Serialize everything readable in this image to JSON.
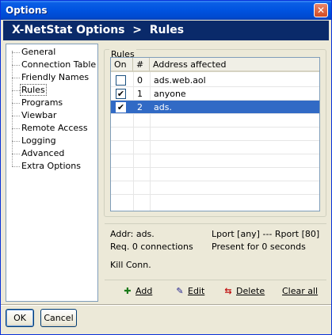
{
  "window": {
    "title": "Options",
    "close_glyph": "✕"
  },
  "header": {
    "app": "X-NetStat Options",
    "separator": ">",
    "section": "Rules"
  },
  "tree": {
    "items": [
      {
        "label": "General"
      },
      {
        "label": "Connection Table"
      },
      {
        "label": "Friendly Names"
      },
      {
        "label": "Rules",
        "selected": true
      },
      {
        "label": "Programs"
      },
      {
        "label": "Viewbar"
      },
      {
        "label": "Remote Access"
      },
      {
        "label": "Logging"
      },
      {
        "label": "Advanced"
      },
      {
        "label": "Extra Options"
      }
    ]
  },
  "rules": {
    "group_label": "Rules",
    "columns": [
      "On",
      "#",
      "Address affected"
    ],
    "rows": [
      {
        "on": false,
        "num": "0",
        "address": "ads.web.aol",
        "selected": false
      },
      {
        "on": true,
        "num": "1",
        "address": "anyone",
        "selected": false
      },
      {
        "on": true,
        "num": "2",
        "address": "ads.",
        "selected": true
      }
    ],
    "checkbox_glyph": "✔"
  },
  "details": {
    "addr": "Addr: ads.",
    "ports": "Lport [any] --- Rport [80]",
    "req": "Req. 0 connections",
    "present": "Present for 0 seconds",
    "kill": "Kill Conn."
  },
  "actions": {
    "add": {
      "icon": "add-icon",
      "glyph": "✚",
      "label": "Add",
      "color": "#1a7a1a"
    },
    "edit": {
      "icon": "edit-icon",
      "glyph": "✎",
      "label": "Edit",
      "color": "#1a1a8a"
    },
    "delete": {
      "icon": "delete-icon",
      "glyph": "⇆",
      "label": "Delete",
      "color": "#c01010"
    },
    "clear": {
      "label": "Clear all"
    }
  },
  "buttons": {
    "ok": "OK",
    "cancel": "Cancel"
  },
  "colors": {
    "titlebar": "#0053e0",
    "header_band": "#0a2a6a",
    "selection": "#316ac5"
  }
}
